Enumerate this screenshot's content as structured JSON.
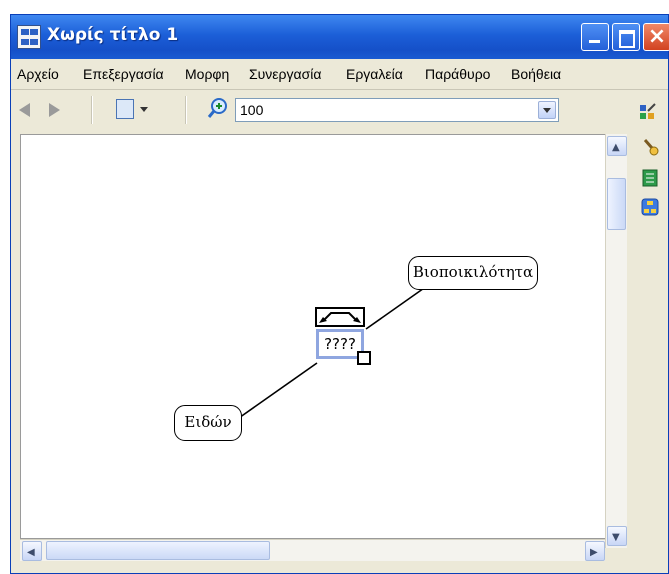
{
  "window": {
    "title": "Χωρίς τίτλο 1",
    "accent": "#1c5fd8",
    "close_color": "#d24220"
  },
  "menu": {
    "items": [
      "Αρχείο",
      "Επεξεργασία",
      "Μορφη",
      "Συνεργασία",
      "Εργαλεία",
      "Παράθυρο",
      "Βοήθεια"
    ]
  },
  "toolbar": {
    "back_icon": "arrow-left-icon",
    "forward_icon": "arrow-right-icon",
    "view_icon": "view-options-icon",
    "zoom_icon": "zoom-in-icon",
    "zoom_value": "100"
  },
  "sidebar": {
    "icons": [
      "styles-icon",
      "brush-icon",
      "notes-icon",
      "concept-map-icon"
    ]
  },
  "map": {
    "concepts": [
      {
        "label": "Βιοποικιλότητα"
      },
      {
        "label": "Ειδών"
      }
    ],
    "linking_phrase": "????"
  }
}
